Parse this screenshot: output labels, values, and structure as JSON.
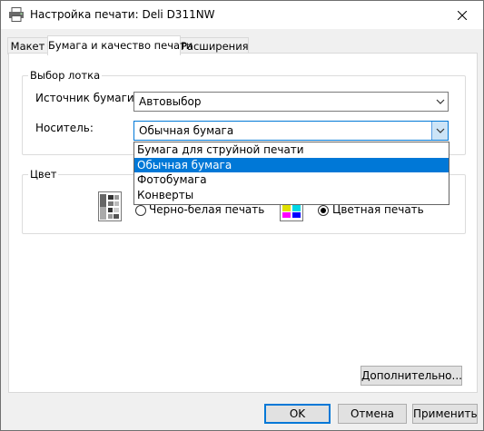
{
  "window": {
    "title": "Настройка печати: Deli D311NW"
  },
  "tabs": [
    {
      "label": "Макет"
    },
    {
      "label": "Бумага и качество печати",
      "active": true
    },
    {
      "label": "Расширения"
    }
  ],
  "tray_group": {
    "title": "Выбор лотка",
    "source_label": "Источник бумаги:",
    "source_value": "Автовыбор",
    "media_label": "Носитель:",
    "media_value": "Обычная бумага",
    "media_options": [
      "Бумага для струйной печати",
      "Обычная бумага",
      "Фотобумага",
      "Конверты"
    ],
    "media_selected_index": 1
  },
  "color_group": {
    "title": "Цвет",
    "bw_label": "Черно-белая печать",
    "color_label": "Цветная печать",
    "selected": "color"
  },
  "buttons": {
    "advanced": "Дополнительно...",
    "ok": "OK",
    "cancel": "Отмена",
    "apply": "Применить"
  },
  "icons": {
    "title": "printer-icon",
    "close": "close-icon",
    "bw": "bw-print-icon",
    "color": "color-print-icon"
  },
  "colors": {
    "accent": "#0078d7",
    "selected_item_bg": "#0078d7",
    "window_bg": "#f0f0f0",
    "panel_bg": "#ffffff"
  }
}
